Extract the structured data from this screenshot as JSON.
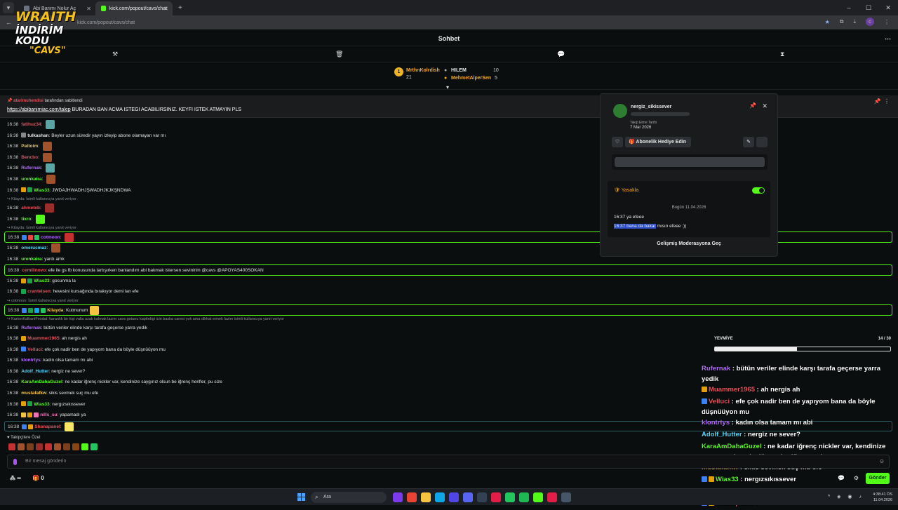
{
  "browser": {
    "tabs": [
      {
        "title": "Abi Barımı Nolur Aç",
        "active": false,
        "favicon_color": "#6b7280"
      },
      {
        "title": "kick.com/popout/cavs/chat",
        "active": true,
        "favicon_color": "#53fc18"
      }
    ],
    "url": "kick.com/popout/cavs/chat",
    "new_tab": "+",
    "profile_initial": "c"
  },
  "overlay_logo": {
    "line1": "WRAITH",
    "line2": "İNDİRİM KODU",
    "line3": "\"CAVS\""
  },
  "chat_header": {
    "title": "Sohbet"
  },
  "leaderboard": [
    {
      "rank": "1",
      "name": "MrthnKolrdish",
      "points": "21"
    },
    {
      "name": "HILEM",
      "points": "10"
    },
    {
      "name": "MehmetAlperSen",
      "points": "5"
    }
  ],
  "pinned": {
    "by_user": "atarimuhendisi",
    "by_text": "tarafından sabitlendi",
    "link": "https://abibanimiac.com/talep",
    "message": " BURADAN BAN ACMA ISTEGI ACABILIRSINIZ. KEYFI ISTEK ATMAYIN PLS"
  },
  "messages": [
    {
      "time": "16:38",
      "user": "fatihuz34",
      "color": "#e6525b",
      "text": "",
      "badges": [],
      "emote": "#5aa6a6",
      "hl": ""
    },
    {
      "time": "16:38",
      "user": "tulkashan",
      "color": "#e6e6e6",
      "text": "Beyler uzun süredir yayın izleyip abone olamayan var mı",
      "badges": [
        "#888"
      ],
      "emote": "",
      "hl": ""
    },
    {
      "time": "16:38",
      "user": "Pattoim",
      "color": "#f5c542",
      "text": "",
      "badges": [],
      "emote": "#a0522d",
      "hl": ""
    },
    {
      "time": "16:38",
      "user": "Bencbo",
      "color": "#e6525b",
      "text": "",
      "badges": [],
      "emote": "#a0522d",
      "hl": ""
    },
    {
      "time": "16:38",
      "user": "Rufernak",
      "color": "#b36bff",
      "text": "",
      "badges": [],
      "emote": "#5aa6a6",
      "hl": ""
    },
    {
      "time": "16:38",
      "user": "urenkaira",
      "color": "#53fc18",
      "text": "",
      "badges": [],
      "emote": "#a0522d",
      "hl": ""
    },
    {
      "time": "16:38",
      "user": "Wias33",
      "color": "#53fc18",
      "text": "JWDAJHWADHJŞWADHJKJKŞNDWA",
      "badges": [
        "#e3a008",
        "#16a34a"
      ],
      "emote": "",
      "hl": ""
    },
    {
      "reply": "Kilayda: ",
      "reply_text": "İsimli kullanıcıya yanıt veriyor"
    },
    {
      "time": "16:38",
      "user": "ahmeteb",
      "color": "#e6525b",
      "text": "",
      "badges": [],
      "emote": "#9b2c2c",
      "hl": ""
    },
    {
      "time": "16:38",
      "user": "tixro",
      "color": "#53fc18",
      "text": "",
      "badges": [],
      "emote": "#53fc18",
      "hl": ""
    },
    {
      "reply": "Kilayda: ",
      "reply_text": "İsimli kullanıcıya yanıt veriyor"
    },
    {
      "time": "16:38",
      "user": "cotmoon",
      "color": "#b36bff",
      "text": "",
      "badges": [
        "#3b82f6",
        "#ef4444",
        "#22c55e"
      ],
      "emote": "#c53030",
      "hl": "hl"
    },
    {
      "time": "16:38",
      "user": "omerucmaz",
      "color": "#53d8fc",
      "text": "",
      "badges": [],
      "emote": "#a0522d",
      "hl": ""
    },
    {
      "time": "16:38",
      "user": "urenkaira",
      "color": "#53fc18",
      "text": "yardı amk",
      "badges": [],
      "emote": "",
      "hl": ""
    },
    {
      "time": "16:38",
      "user": "cemilinovo",
      "color": "#e6525b",
      "text": "efe ile gs fb konusunda tartışırken banlandım abi bakmak istersen sevinirim @cavs @APOYAS400SOKAN",
      "badges": [],
      "emote": "",
      "hl": "hl",
      "mention": "@cavs @APOYAS400SOKAN"
    },
    {
      "time": "16:38",
      "user": "Wias33",
      "color": "#53fc18",
      "text": "gocunma la",
      "badges": [
        "#e3a008",
        "#16a34a"
      ],
      "emote": "",
      "hl": ""
    },
    {
      "time": "16:38",
      "user": "crantelsen",
      "color": "#e6525b",
      "text": "hevesini kursağında bırakıyor demi lan efe",
      "badges": [
        "#16a34a"
      ],
      "emote": "",
      "hl": ""
    },
    {
      "reply": "cotmoon: ",
      "reply_text": "İsimli kullanıcıya yanıt veriyor"
    },
    {
      "time": "16:38",
      "user": "Kilayda",
      "color": "#f5c542",
      "text": "Kutmunum",
      "badges": [
        "#3b82f6",
        "#16a34a",
        "#0ea5e9",
        "#22c55e"
      ],
      "emote": "#f5c542",
      "hl": "hl"
    },
    {
      "reply": "KartonKalkaniFeodal: ",
      "reply_text": "karanlık bir kişi valla uzak kalmak lazım cavs gotunu kaptirdigi icin baska caresi yok ama dikkat etmek lazim isimli kullanıcıya yanıt veriyor"
    },
    {
      "time": "16:38",
      "user": "Rufernak",
      "color": "#b36bff",
      "text": "bütün veriler elinde karşı tarafa geçerse yarra yedik",
      "badges": [],
      "emote": "",
      "hl": ""
    },
    {
      "time": "16:38",
      "user": "Muammer1965",
      "color": "#e6525b",
      "text": "ah nergis ah",
      "badges": [
        "#e3a008"
      ],
      "emote": "",
      "hl": ""
    },
    {
      "time": "16:38",
      "user": "Velluci",
      "color": "#e6525b",
      "text": "efe çok nadir ben de yapıyom bana da böyle düşnüüyon mu",
      "badges": [
        "#3b82f6"
      ],
      "emote": "",
      "hl": ""
    },
    {
      "time": "16:38",
      "user": "klontrtys",
      "color": "#b36bff",
      "text": "kadın olsa tamam mı abi",
      "badges": [],
      "emote": "",
      "hl": ""
    },
    {
      "time": "16:38",
      "user": "Adolf_Hutter",
      "color": "#53d8fc",
      "text": "nergiz ne sever?",
      "badges": [],
      "emote": "",
      "hl": ""
    },
    {
      "time": "16:38",
      "user": "KaraAmDahaGuzel",
      "color": "#53fc18",
      "text": "ne kadar iğrenç nickler var, kendinize saygınız olsun be iğrenç herifler, pu size",
      "badges": [],
      "emote": "",
      "hl": ""
    },
    {
      "time": "16:38",
      "user": "mustafafkw",
      "color": "#f5c542",
      "text": "sikis sevmek suç mu efe",
      "badges": [],
      "emote": "",
      "hl": ""
    },
    {
      "time": "16:38",
      "user": "Wias33",
      "color": "#53fc18",
      "text": "nergızsıkıssever",
      "badges": [
        "#e3a008",
        "#16a34a"
      ],
      "emote": "",
      "hl": ""
    },
    {
      "time": "16:38",
      "user": "nills_su",
      "color": "#f472b6",
      "text": "yapamadı ya",
      "badges": [
        "#f5c542",
        "#e3a008",
        "#f472b6"
      ],
      "emote": "",
      "hl": ""
    },
    {
      "time": "16:38",
      "user": "Shanapanel",
      "color": "#e6525b",
      "text": "",
      "badges": [
        "#3b82f6",
        "#e3a008"
      ],
      "emote": "#f5e663",
      "hl": "hl2"
    }
  ],
  "user_popup": {
    "username": "nergiz_sikissever",
    "follow_label": "Takip Etme Tarihi",
    "follow_date": "7 Mar 2026",
    "gift_button": "Abonelik Hediye Edin",
    "ban_label": "Yasakla",
    "day_label": "Bugün 11.04.2026",
    "msg1_time": "16:37",
    "msg1_text": "ya efeee",
    "msg2_time": "16:37",
    "msg2_selected": "bana da bakar",
    "msg2_rest": " mısın efeee :))",
    "advanced": "Gelişmiş Moderasyona Geç"
  },
  "yevmiye": {
    "label": "YEVMİYE",
    "count": "14 / 30",
    "fraction": 0.467
  },
  "overlay_chat": [
    {
      "user": "Rufernak",
      "color": "#b36bff",
      "text": " : bütün veriler elinde karşı tarafa geçerse yarra yedik",
      "badges": []
    },
    {
      "user": "Muammer1965",
      "color": "#e6525b",
      "text": " : ah nergis ah",
      "badges": [
        "#e3a008"
      ]
    },
    {
      "user": "Velluci",
      "color": "#e6525b",
      "text": " : efe çok nadir ben de yapıyom bana da böyle düşnüüyon mu",
      "badges": [
        "#3b82f6"
      ]
    },
    {
      "user": "klontrtys",
      "color": "#b36bff",
      "text": " : kadın olsa tamam mı abi",
      "badges": []
    },
    {
      "user": "Adolf_Hutter",
      "color": "#53d8fc",
      "text": " : nergiz ne sever?",
      "badges": []
    },
    {
      "user": "KaraAmDahaGuzel",
      "color": "#53fc18",
      "text": " : ne kadar iğrenç nickler var, kendinize saygınız olsun be iğrenç herifler, pu size",
      "badges": []
    },
    {
      "user": "mustafafkw",
      "color": "#f5c542",
      "text": " : sikis sevmek suç mu efe",
      "badges": []
    },
    {
      "user": "Wias33",
      "color": "#53fc18",
      "text": " : nergızsıkıssever",
      "badges": [
        "#3b82f6",
        "#e3a008"
      ]
    },
    {
      "user": "nills_su",
      "color": "#f472b6",
      "text": " : yapamadı ya",
      "badges": [
        "#b36bff",
        "#e6525b",
        "#e3a008"
      ]
    },
    {
      "user": "Shanapanel",
      "color": "#e6525b",
      "text": " : ",
      "badges": [
        "#3b82f6",
        "#e3a008"
      ]
    }
  ],
  "followers_label": "Takipçilere Özel",
  "input": {
    "placeholder": "Bir mesaj gönderin",
    "send": "Gönder"
  },
  "bottom": {
    "infinity": "∞",
    "count": "0"
  },
  "taskbar": {
    "search": "Ara",
    "time": "4:38:41 ÖS",
    "date": "11.04.2026"
  }
}
